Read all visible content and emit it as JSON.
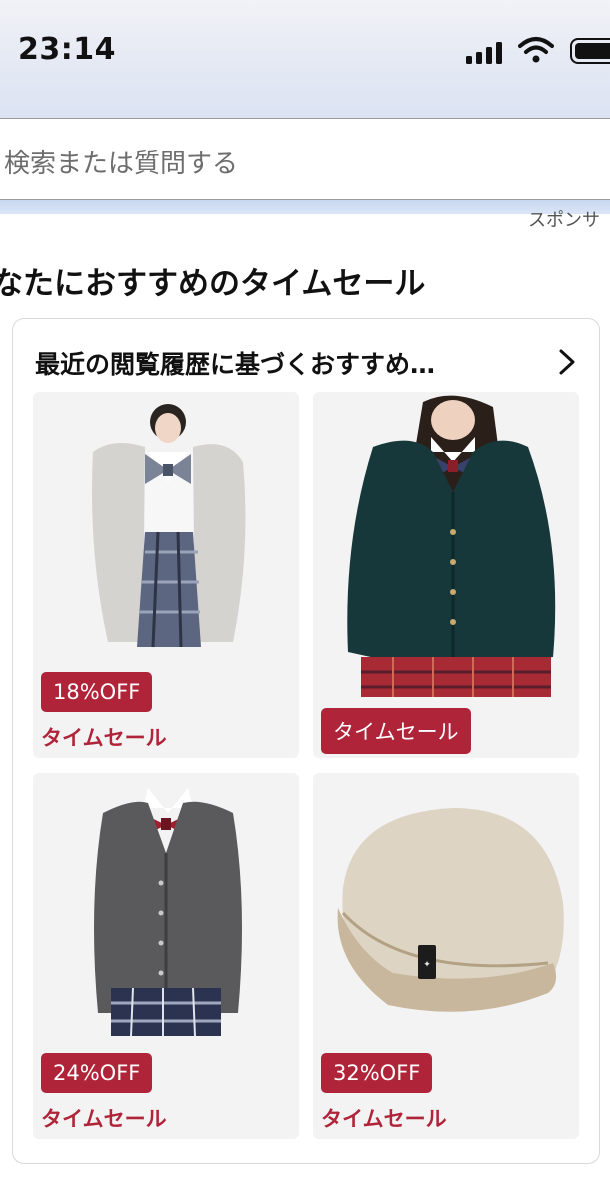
{
  "status_bar": {
    "time": "23:14"
  },
  "search": {
    "placeholder": "検索または質問する"
  },
  "sponsored_label": "スポンサ",
  "section_title": "なたにおすすめのタイムセール",
  "card": {
    "title": "最近の閲覧履歴に基づくおすすめ…",
    "products": [
      {
        "name": "grey hoodie school uniform",
        "discount": "18%OFF",
        "deal": "タイムセール"
      },
      {
        "name": "dark green cardigan uniform",
        "discount": "",
        "deal": "タイムセール"
      },
      {
        "name": "grey cardigan uniform",
        "discount": "24%OFF",
        "deal": "タイムセール"
      },
      {
        "name": "beige knit beanie",
        "discount": "32%OFF",
        "deal": "タイムセール"
      }
    ]
  },
  "colors": {
    "deal_red": "#b0243a",
    "tile_bg": "#f3f3f3"
  }
}
